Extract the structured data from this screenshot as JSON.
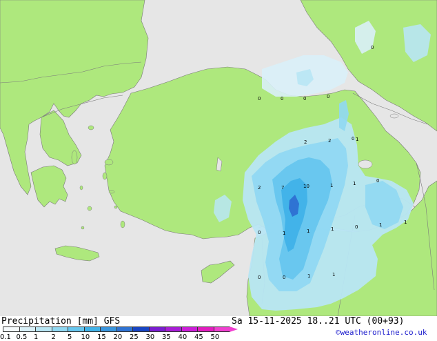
{
  "legend": {
    "title": "Precipitation [mm] GFS",
    "ticks": [
      "0.1",
      "0.5",
      "1",
      "2",
      "5",
      "10",
      "15",
      "20",
      "25",
      "30",
      "35",
      "40",
      "45",
      "50"
    ],
    "colors": [
      "#f5fafc",
      "#d9f0f8",
      "#b8e6f4",
      "#90d8f2",
      "#66c6ee",
      "#40b2e8",
      "#3a96de",
      "#2f73d3",
      "#1845c4",
      "#7a1ed0",
      "#a81ed6",
      "#cc1ed8",
      "#e21ebf",
      "#f040d0"
    ]
  },
  "run_info": "Sa 15-11-2025 18..21 UTC (00+93)",
  "credit": "©weatheronline.co.uk",
  "map": {
    "colors": {
      "sea": "#e6e6e6",
      "land": "#aee87d",
      "border": "#7a7a7a"
    },
    "value_labels": [
      "0",
      "0",
      "0",
      "0",
      "0",
      "0",
      "2",
      "2",
      "0",
      "2",
      "7",
      "10",
      "1",
      "1",
      "0",
      "1",
      "1",
      "0",
      "1",
      "1",
      "1",
      "0",
      "0",
      "1",
      "1",
      "1"
    ]
  }
}
